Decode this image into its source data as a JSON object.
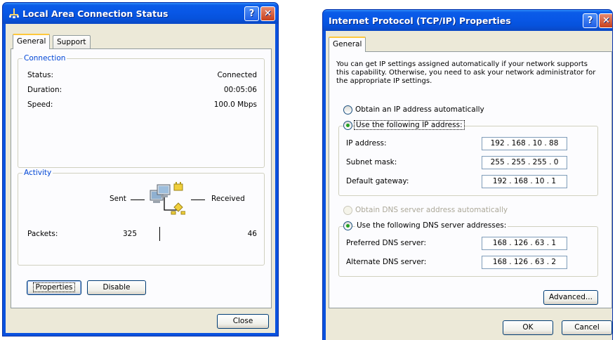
{
  "status_window": {
    "title": "Local Area Connection Status",
    "tabs": [
      "General",
      "Support"
    ],
    "connection_group": "Connection",
    "status_label": "Status:",
    "status_value": "Connected",
    "duration_label": "Duration:",
    "duration_value": "00:05:06",
    "speed_label": "Speed:",
    "speed_value": "100.0 Mbps",
    "activity_group": "Activity",
    "sent_label": "Sent",
    "received_label": "Received",
    "packets_label": "Packets:",
    "packets_sent": "325",
    "packets_received": "46",
    "properties_label": "Properties",
    "disable_label": "Disable",
    "close_label": "Close"
  },
  "tcpip_window": {
    "title": "Internet Protocol (TCP/IP) Properties",
    "tab": "General",
    "description": "You can get IP settings assigned automatically if your network supports this capability. Otherwise, you need to ask your network administrator for the appropriate IP settings.",
    "obtain_ip_label": "Obtain an IP address automatically",
    "use_ip_label": "Use the following IP address:",
    "ip_address_label": "IP address:",
    "ip_address_value": "192 . 168 . 10 . 88",
    "subnet_label": "Subnet mask:",
    "subnet_value": "255 . 255 . 255 . 0",
    "gateway_label": "Default gateway:",
    "gateway_value": "192 . 168 . 10 . 1",
    "obtain_dns_label": "Obtain DNS server address automatically",
    "use_dns_label": "Use the following DNS server addresses:",
    "preferred_dns_label": "Preferred DNS server:",
    "preferred_dns_value": "168 . 126 . 63 . 1",
    "alternate_dns_label": "Alternate DNS server:",
    "alternate_dns_value": "168 . 126 . 63 . 2",
    "advanced_label": "Advanced...",
    "ok_label": "OK",
    "cancel_label": "Cancel"
  },
  "colors": {
    "titlebar": "#0a52de",
    "dialog_bg": "#ece9d8",
    "group_title": "#0046d5",
    "tab_highlight": "#ffc83c"
  },
  "icons": [
    "network-connection-icon",
    "help-icon",
    "close-icon",
    "network-activity-icon"
  ]
}
